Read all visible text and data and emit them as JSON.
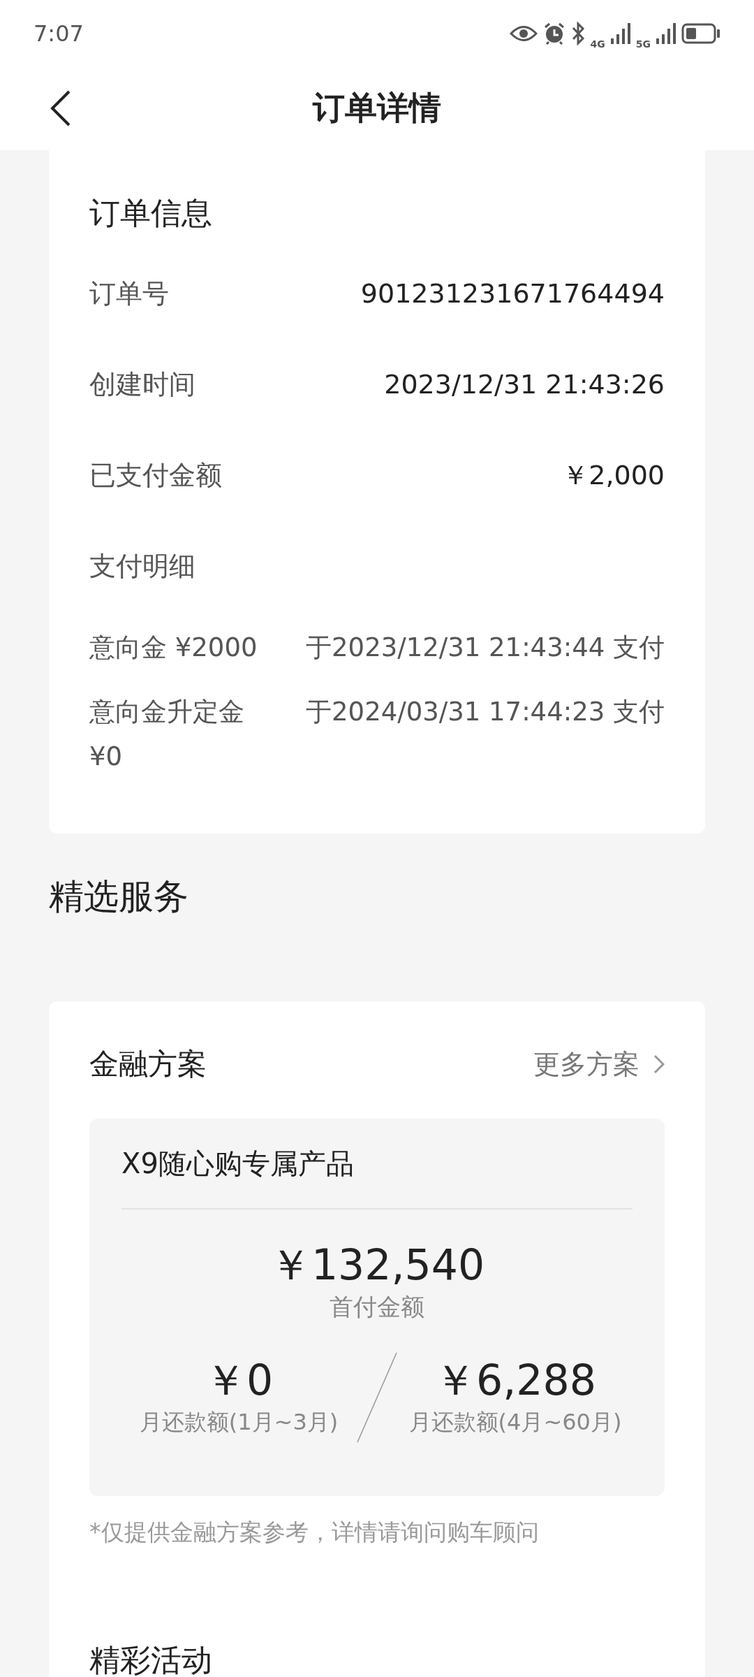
{
  "status_bar": {
    "time": "7:07",
    "network_1": "4G",
    "network_2": "5G"
  },
  "nav": {
    "title": "订单详情"
  },
  "order_info": {
    "title": "订单信息",
    "rows": [
      {
        "label": "订单号",
        "value": "901231231671764494"
      },
      {
        "label": "创建时间",
        "value": "2023/12/31 21:43:26"
      },
      {
        "label": "已支付金额",
        "value": "￥2,000"
      },
      {
        "label": "支付明细",
        "value": ""
      }
    ],
    "payments": [
      {
        "label": "意向金 ¥2000",
        "value": "于2023/12/31 21:43:44 支付"
      },
      {
        "label": "意向金升定金 ¥0",
        "value": "于2024/03/31 17:44:23 支付"
      }
    ]
  },
  "services_heading": "精选服务",
  "finance": {
    "title": "金融方案",
    "more": "更多方案",
    "product": "X9随心购专属产品",
    "down_payment": "￥132,540",
    "down_payment_label": "首付金额",
    "monthly": [
      {
        "amount": "￥0",
        "label": "月还款额(1月~3月)"
      },
      {
        "amount": "￥6,288",
        "label": "月还款额(4月~60月)"
      }
    ],
    "note": "*仅提供金融方案参考，详情请询问购车顾问"
  },
  "activities_title": "精彩活动"
}
